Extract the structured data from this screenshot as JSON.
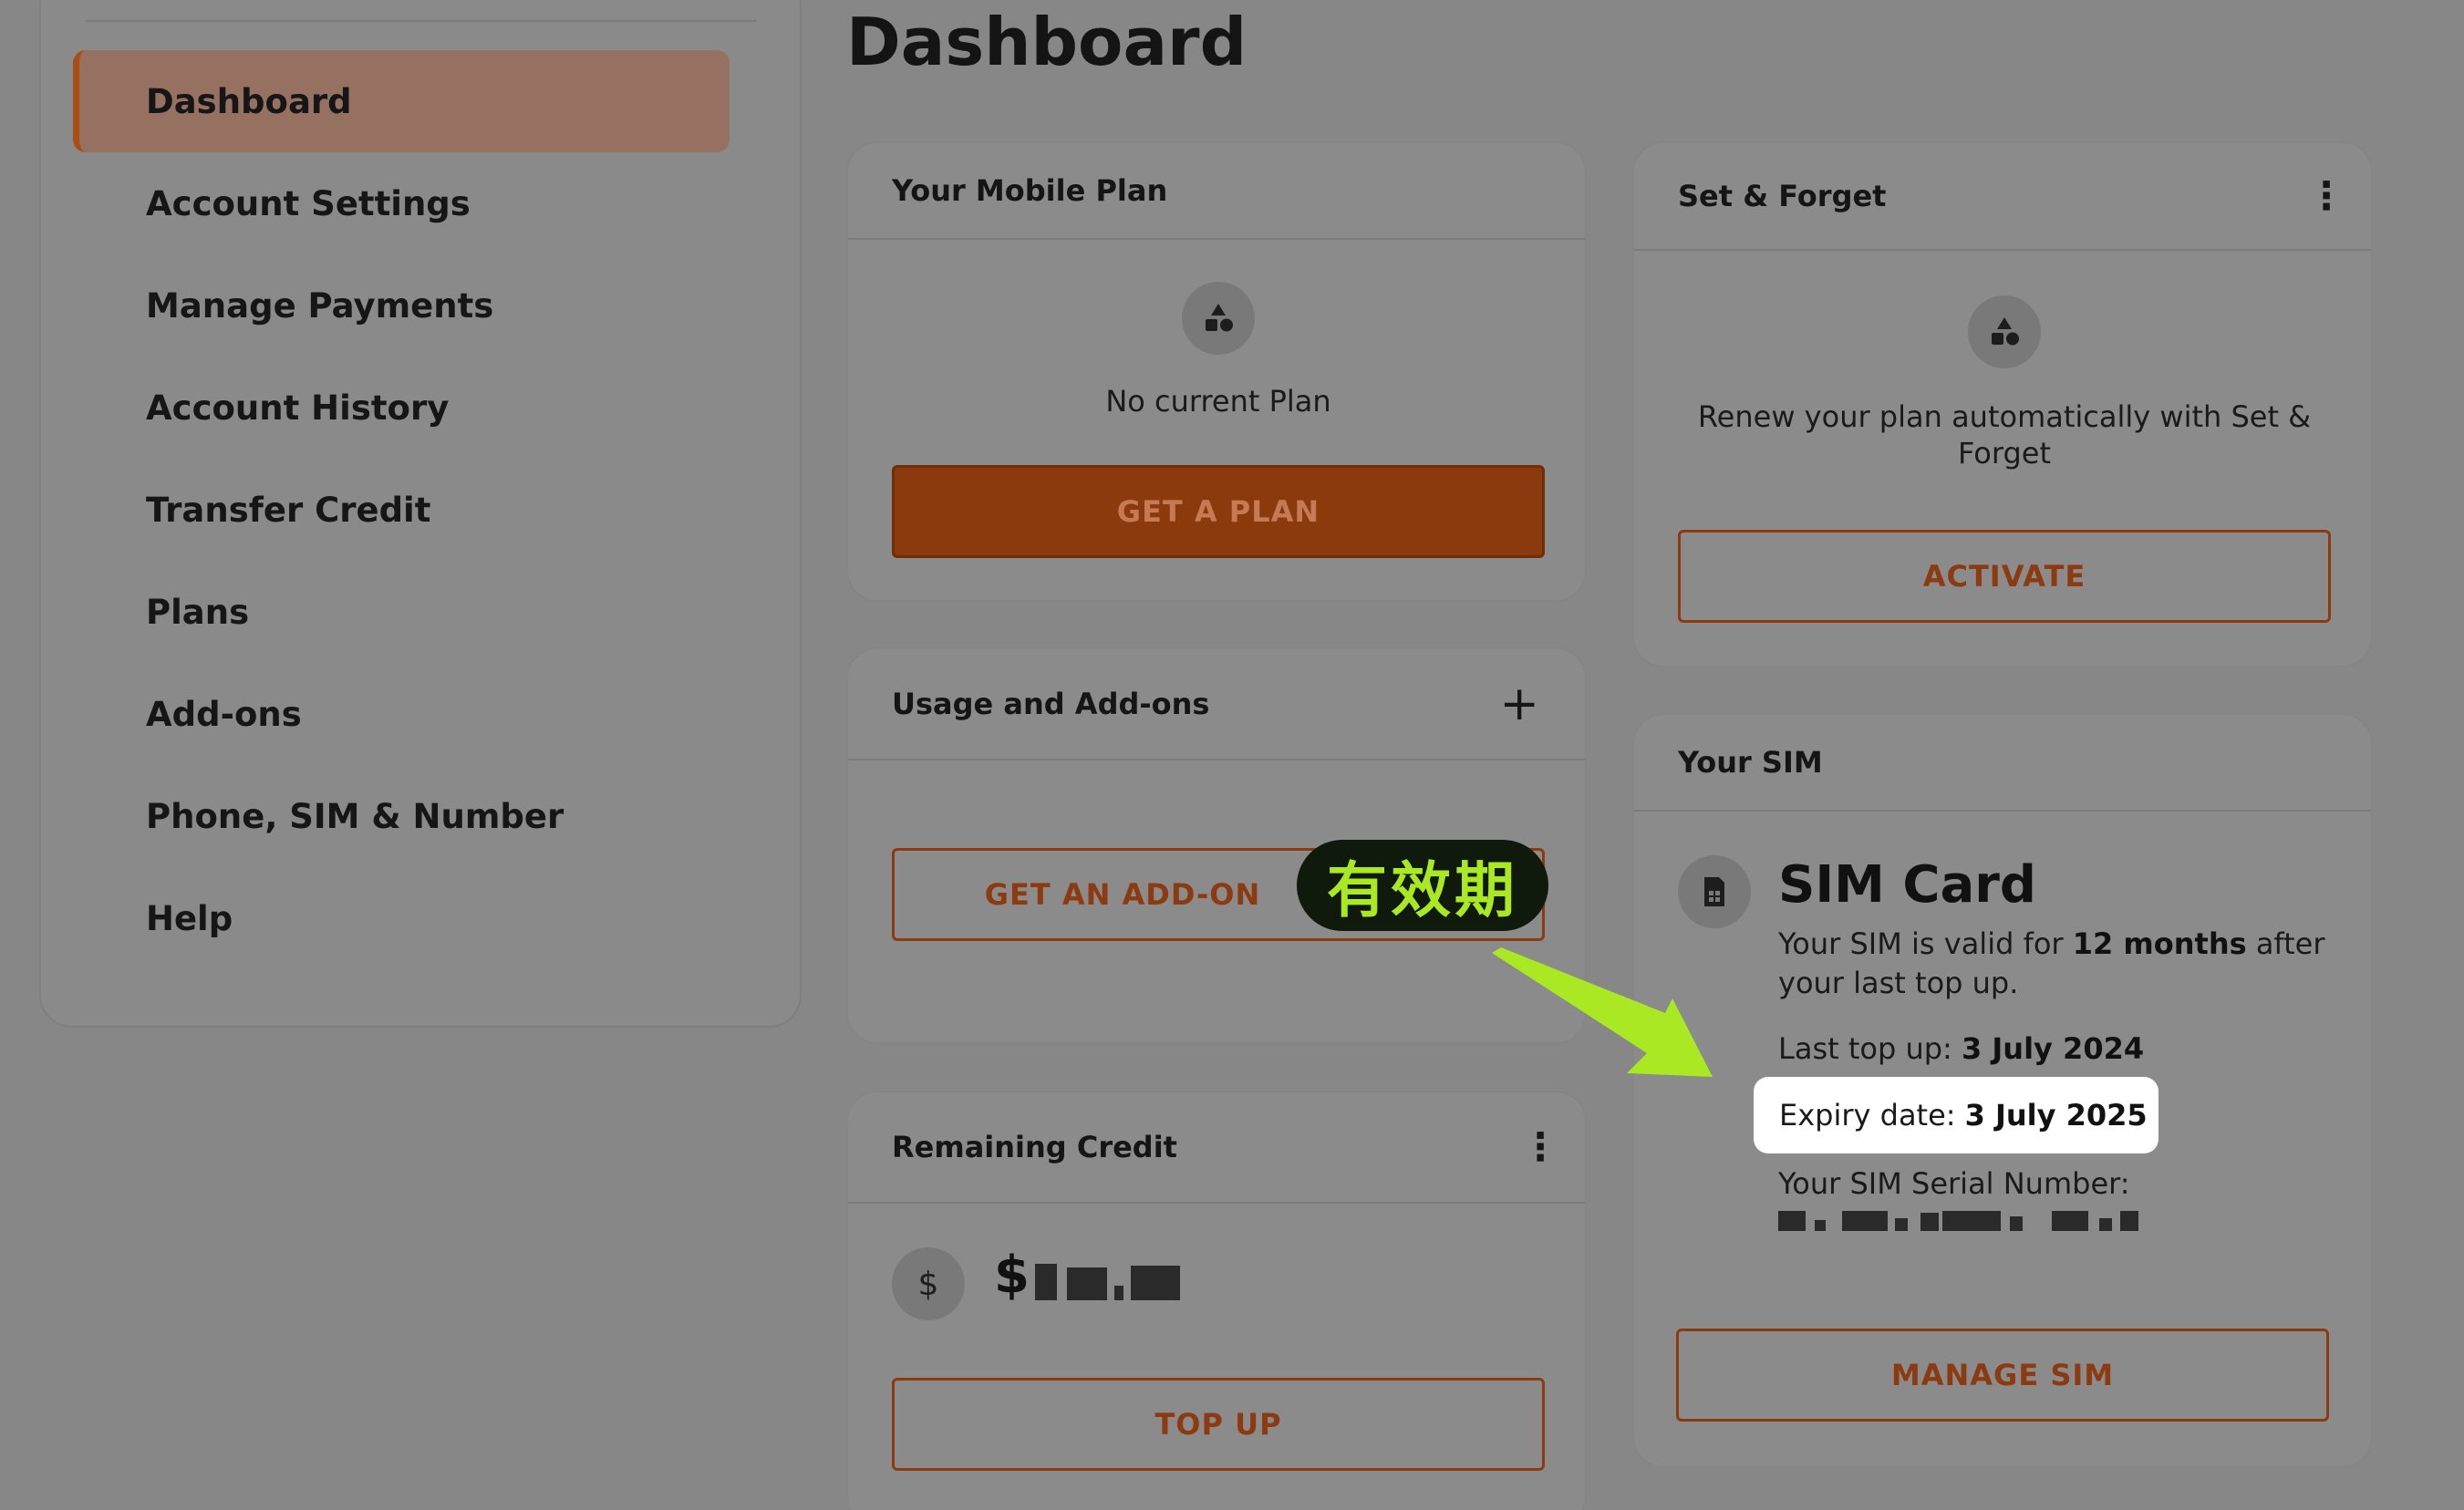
{
  "sidebar": {
    "items": [
      {
        "label": "Dashboard",
        "active": true
      },
      {
        "label": "Account Settings"
      },
      {
        "label": "Manage Payments"
      },
      {
        "label": "Account History"
      },
      {
        "label": "Transfer Credit"
      },
      {
        "label": "Plans"
      },
      {
        "label": "Add-ons"
      },
      {
        "label": "Phone, SIM & Number"
      },
      {
        "label": "Help"
      }
    ]
  },
  "page": {
    "title": "Dashboard"
  },
  "mobile_plan": {
    "header": "Your Mobile Plan",
    "empty_text": "No current Plan",
    "button": "GET A PLAN",
    "icon": "shapes-icon"
  },
  "usage": {
    "header": "Usage and Add-ons",
    "button": "GET AN ADD-ON",
    "icon": "plus-icon"
  },
  "credit": {
    "header": "Remaining Credit",
    "amount_prefix": "$",
    "amount_obscured": true,
    "button": "TOP UP",
    "icon": "dollar-icon"
  },
  "set_forget": {
    "header": "Set & Forget",
    "text": "Renew your plan automatically with Set & Forget",
    "button": "ACTIVATE",
    "icon": "shapes-icon"
  },
  "sim": {
    "header": "Your SIM",
    "title": "SIM Card",
    "validity_pre": "Your SIM is valid for",
    "validity_bold": "12 months",
    "validity_post": "after your last top up.",
    "last_topup_label": "Last top up:",
    "last_topup_value": "3 July 2024",
    "expiry_label": "Expiry date:",
    "expiry_value": "3 July 2025",
    "serial_label": "Your SIM Serial Number:",
    "serial_obscured": true,
    "button": "MANAGE SIM",
    "icon": "sim-card-icon"
  },
  "annotation": {
    "badge_text": "有效期",
    "badge_color": "#a9e822",
    "arrow_color": "#a9e822"
  },
  "colors": {
    "accent": "#8a3a0c",
    "overlay_background": "#878787",
    "highlight": "#ffffff"
  }
}
